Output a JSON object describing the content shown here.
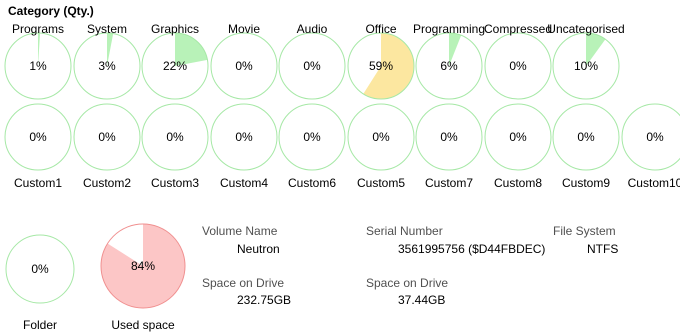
{
  "section_title": "Category (Qty.)",
  "colors": {
    "ring": "#a6e8a6",
    "green_fill": "#b8f2b8",
    "office_fill": "#fce7a0",
    "used_fill": "#fcc6c6",
    "used_ring": "#f09090"
  },
  "categories": [
    {
      "label": "Programs",
      "pct_text": "1%",
      "value": 1,
      "fill": "#b8f2b8"
    },
    {
      "label": "System",
      "pct_text": "3%",
      "value": 3,
      "fill": "#b8f2b8"
    },
    {
      "label": "Graphics",
      "pct_text": "22%",
      "value": 22,
      "fill": "#b8f2b8"
    },
    {
      "label": "Movie",
      "pct_text": "0%",
      "value": 0,
      "fill": "#b8f2b8"
    },
    {
      "label": "Audio",
      "pct_text": "0%",
      "value": 0,
      "fill": "#b8f2b8"
    },
    {
      "label": "Office",
      "pct_text": "59%",
      "value": 59,
      "fill": "#fce7a0"
    },
    {
      "label": "Programming",
      "pct_text": "6%",
      "value": 6,
      "fill": "#b8f2b8"
    },
    {
      "label": "Compressed",
      "pct_text": "0%",
      "value": 0,
      "fill": "#b8f2b8"
    },
    {
      "label": "Uncategorised",
      "pct_text": "10%",
      "value": 10,
      "fill": "#b8f2b8"
    }
  ],
  "customs": [
    {
      "label": "Custom1",
      "pct_text": "0%",
      "value": 0
    },
    {
      "label": "Custom2",
      "pct_text": "0%",
      "value": 0
    },
    {
      "label": "Custom3",
      "pct_text": "0%",
      "value": 0
    },
    {
      "label": "Custom4",
      "pct_text": "0%",
      "value": 0
    },
    {
      "label": "Custom6",
      "pct_text": "0%",
      "value": 0
    },
    {
      "label": "Custom5",
      "pct_text": "0%",
      "value": 0
    },
    {
      "label": "Custom7",
      "pct_text": "0%",
      "value": 0
    },
    {
      "label": "Custom8",
      "pct_text": "0%",
      "value": 0
    },
    {
      "label": "Custom9",
      "pct_text": "0%",
      "value": 0
    },
    {
      "label": "Custom10",
      "pct_text": "0%",
      "value": 0
    }
  ],
  "folder": {
    "label": "Folder",
    "pct_text": "0%",
    "value": 0
  },
  "used_space": {
    "label": "Used space",
    "pct_text": "84%",
    "value": 84
  },
  "volume": {
    "volume_name_label": "Volume Name",
    "volume_name": "Neutron",
    "serial_label": "Serial Number",
    "serial_value": "3561995756 ($D44FBDEC)",
    "fs_label": "File System",
    "fs_value": "NTFS",
    "space_on_drive_label": "Space on Drive",
    "space_on_drive_value": "232.75GB",
    "space_free_label": "Space on Drive",
    "space_free_value": "37.44GB"
  }
}
